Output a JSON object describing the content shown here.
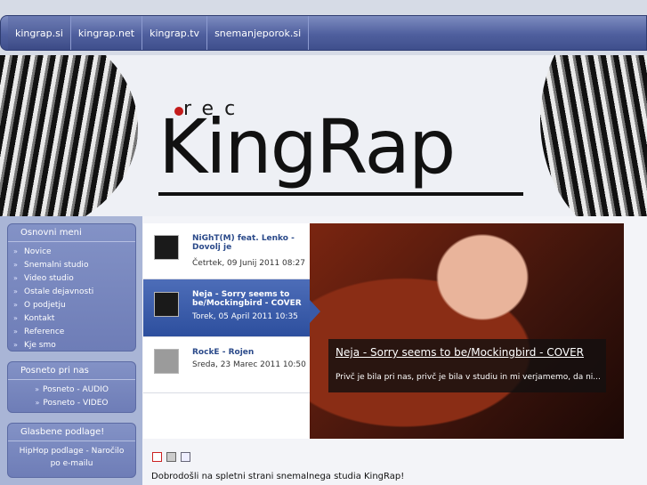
{
  "topnav": {
    "tabs": [
      {
        "label": "kingrap.si",
        "active": true
      },
      {
        "label": "kingrap.net",
        "active": false
      },
      {
        "label": "kingrap.tv",
        "active": false
      },
      {
        "label": "snemanjeporok.si",
        "active": false
      }
    ]
  },
  "banner": {
    "logo_small": "rec",
    "logo_main": "KingRap"
  },
  "sidebar": {
    "menu_title": "Osnovni meni",
    "menu_items": [
      "Novice",
      "Snemalni studio",
      "Video studio",
      "Ostale dejavnosti",
      "O podjetju",
      "Kontakt",
      "Reference",
      "Kje smo"
    ],
    "posneto_title": "Posneto pri nas",
    "posneto_items": [
      "Posneto - AUDIO",
      "Posneto - VIDEO"
    ],
    "glasbene_title": "Glasbene podlage!",
    "glasbene_item": "HipHop podlage - Naročilo po e-mailu"
  },
  "feature": {
    "entries": [
      {
        "title": "NiGhT(M) feat. Lenko - Dovolj je",
        "date": "Četrtek, 09 Junij 2011 08:27"
      },
      {
        "title": "Neja - Sorry seems to be/Mockingbird - COVER",
        "date": "Torek, 05 April 2011 10:35"
      },
      {
        "title": "RockE - Rojen",
        "date": "Sreda, 23 Marec 2011 10:50"
      }
    ],
    "caption_title": "Neja - Sorry seems to be/Mockingbird - COVER",
    "caption_text": "Privč je bila pri nas, privč je bila v studiu in mi verjamemo, da ni..."
  },
  "welcome": "Dobrodošli na spletni strani snemalnega studia KingRap!"
}
